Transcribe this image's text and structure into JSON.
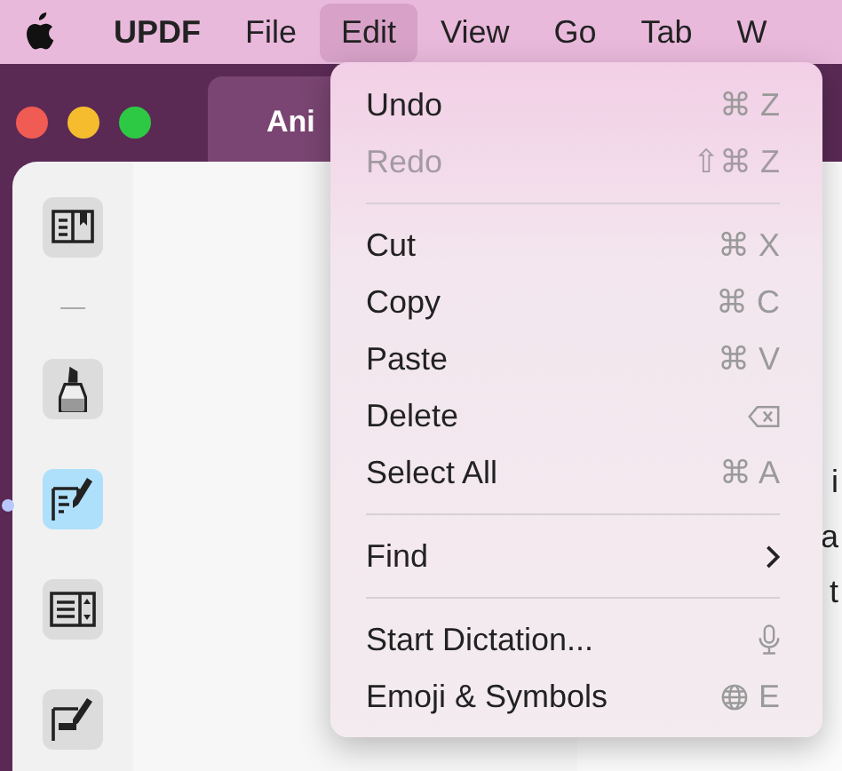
{
  "menu_bar": {
    "items": [
      {
        "label": "UPDF",
        "kind": "app",
        "selected": false
      },
      {
        "label": "File",
        "kind": "menu",
        "selected": false
      },
      {
        "label": "Edit",
        "kind": "menu",
        "selected": true
      },
      {
        "label": "View",
        "kind": "menu",
        "selected": false
      },
      {
        "label": "Go",
        "kind": "menu",
        "selected": false
      },
      {
        "label": "Tab",
        "kind": "menu",
        "selected": false
      },
      {
        "label": "W",
        "kind": "menu",
        "selected": false
      }
    ]
  },
  "window": {
    "tab": {
      "label": "Ani"
    }
  },
  "sidebar": {
    "items": [
      {
        "kind": "bookmark",
        "selected": false
      },
      {
        "kind": "separator"
      },
      {
        "kind": "highlighter",
        "selected": false
      },
      {
        "kind": "edit",
        "selected": true
      },
      {
        "kind": "form",
        "selected": false
      },
      {
        "kind": "sign",
        "selected": false
      }
    ]
  },
  "document": {
    "fragments": [
      "i",
      "a",
      "t"
    ]
  },
  "edit_menu": {
    "items": [
      {
        "kind": "item",
        "label": "Undo",
        "shortcut": "⌘ Z",
        "disabled": false
      },
      {
        "kind": "item",
        "label": "Redo",
        "shortcut": "⇧⌘ Z",
        "disabled": true
      },
      {
        "kind": "separator"
      },
      {
        "kind": "item",
        "label": "Cut",
        "shortcut": "⌘ X",
        "disabled": false
      },
      {
        "kind": "item",
        "label": "Copy",
        "shortcut": "⌘ C",
        "disabled": false
      },
      {
        "kind": "item",
        "label": "Paste",
        "shortcut": "⌘ V",
        "disabled": false
      },
      {
        "kind": "delete",
        "label": "Delete",
        "disabled": false
      },
      {
        "kind": "item",
        "label": "Select All",
        "shortcut": "⌘ A",
        "disabled": false
      },
      {
        "kind": "separator"
      },
      {
        "kind": "submenu",
        "label": "Find",
        "disabled": false
      },
      {
        "kind": "separator"
      },
      {
        "kind": "dictation",
        "label": "Start Dictation...",
        "disabled": false
      },
      {
        "kind": "emoji",
        "label": "Emoji & Symbols",
        "shortcut": "E",
        "disabled": false
      }
    ]
  }
}
